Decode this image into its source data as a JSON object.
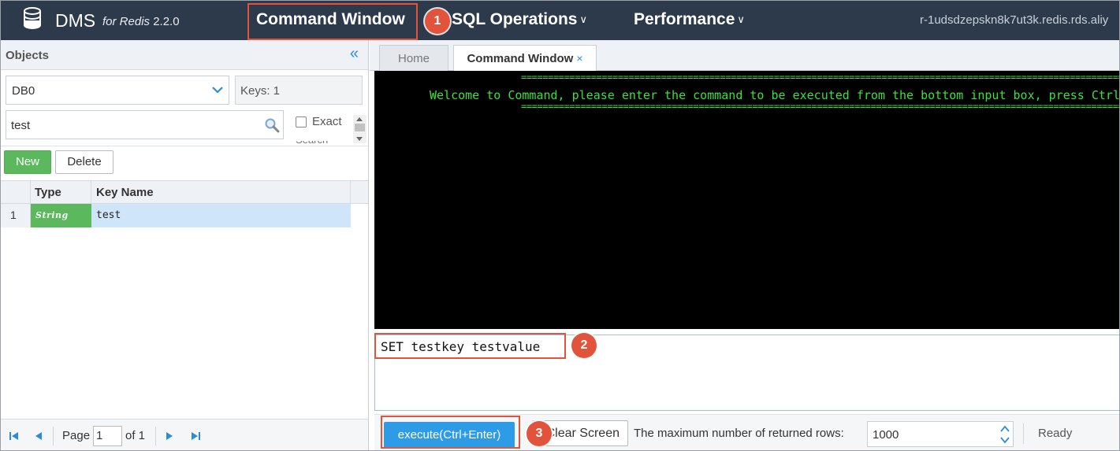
{
  "header": {
    "brand": "DMS",
    "brand_sub": "for Redis",
    "version": "2.2.0",
    "nav": {
      "command_window": "Command Window",
      "sql_operations": "SQL Operations",
      "performance": "Performance"
    },
    "instance": "r-1udsdzepskn8k7ut3k.redis.rds.aliy"
  },
  "markers": [
    "1",
    "2",
    "3"
  ],
  "objects_panel": {
    "title": "Objects",
    "db_select": "DB0",
    "keys_label": "Keys: 1",
    "search_value": "test",
    "exact_label": "Exact",
    "exact_checked": false,
    "new_button": "New",
    "delete_button": "Delete",
    "columns": [
      "Type",
      "Key Name"
    ],
    "rows": [
      {
        "num": "1",
        "type": "String",
        "key": "test"
      }
    ],
    "pager": {
      "page_label": "Page",
      "page_value": "1",
      "of_label": "of 1"
    }
  },
  "tabs": {
    "home": "Home",
    "command_window": "Command Window",
    "close": "×"
  },
  "console": {
    "separator": "========================================================================================================================",
    "welcome": "Welcome to Command, please enter the command to be executed from the bottom input box, press Ctrl+"
  },
  "command_input": {
    "value": "SET testkey testvalue"
  },
  "toolbar": {
    "execute_label": "execute(Ctrl+Enter)",
    "clear_label": "Clear Screen",
    "max_rows_label": "The maximum number of returned rows:",
    "max_rows_value": "1000",
    "status": "Ready"
  },
  "colors": {
    "topbar": "#2d3a4b",
    "accent": "#2e9be6",
    "highlight": "#e2533b",
    "string_type": "#5cb85c",
    "console_text": "#3be03b"
  }
}
